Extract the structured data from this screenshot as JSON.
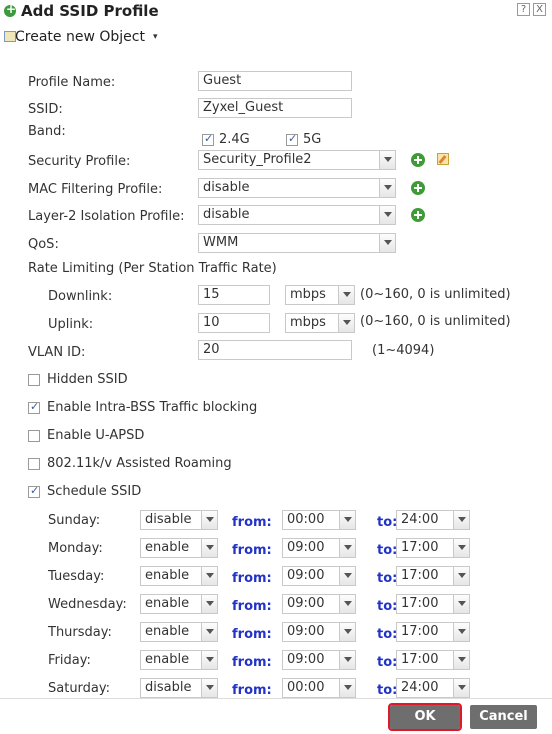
{
  "window": {
    "title": "Add SSID Profile",
    "help_glyph": "?",
    "close_glyph": "X"
  },
  "toolbar": {
    "create_label": "Create new Object",
    "caret": "▾"
  },
  "form": {
    "profile_name": {
      "label": "Profile Name:",
      "value": "Guest"
    },
    "ssid": {
      "label": "SSID:",
      "value": "Zyxel_Guest"
    },
    "band": {
      "label": "Band:",
      "opt_24": "2.4G",
      "opt_5": "5G"
    },
    "security_profile": {
      "label": "Security Profile:",
      "value": "Security_Profile2"
    },
    "mac_filtering": {
      "label": "MAC Filtering Profile:",
      "value": "disable"
    },
    "layer2": {
      "label": "Layer-2 Isolation Profile:",
      "value": "disable"
    },
    "qos": {
      "label": "QoS:",
      "value": "WMM"
    },
    "rate_limiting": {
      "label": "Rate Limiting (Per Station Traffic Rate)"
    },
    "downlink": {
      "label": "Downlink:",
      "value": "15",
      "unit": "mbps",
      "range": "(0~160, 0 is unlimited)"
    },
    "uplink": {
      "label": "Uplink:",
      "value": "10",
      "unit": "mbps",
      "range": "(0~160, 0 is unlimited)"
    },
    "vlan": {
      "label": "VLAN ID:",
      "value": "20",
      "range": "(1~4094)"
    },
    "hidden_ssid": "Hidden SSID",
    "intra_bss": "Enable Intra-BSS Traffic blocking",
    "uapsd": "Enable U-APSD",
    "roaming": "802.11k/v Assisted Roaming",
    "schedule_ssid": "Schedule SSID"
  },
  "schedule": {
    "from_label": "from:",
    "to_label": "to:",
    "days": [
      {
        "day": "Sunday:",
        "state": "disable",
        "from": "00:00",
        "to": "24:00"
      },
      {
        "day": "Monday:",
        "state": "enable",
        "from": "09:00",
        "to": "17:00"
      },
      {
        "day": "Tuesday:",
        "state": "enable",
        "from": "09:00",
        "to": "17:00"
      },
      {
        "day": "Wednesday:",
        "state": "enable",
        "from": "09:00",
        "to": "17:00"
      },
      {
        "day": "Thursday:",
        "state": "enable",
        "from": "09:00",
        "to": "17:00"
      },
      {
        "day": "Friday:",
        "state": "enable",
        "from": "09:00",
        "to": "17:00"
      },
      {
        "day": "Saturday:",
        "state": "disable",
        "from": "00:00",
        "to": "24:00"
      }
    ]
  },
  "buttons": {
    "ok": "OK",
    "cancel": "Cancel"
  }
}
